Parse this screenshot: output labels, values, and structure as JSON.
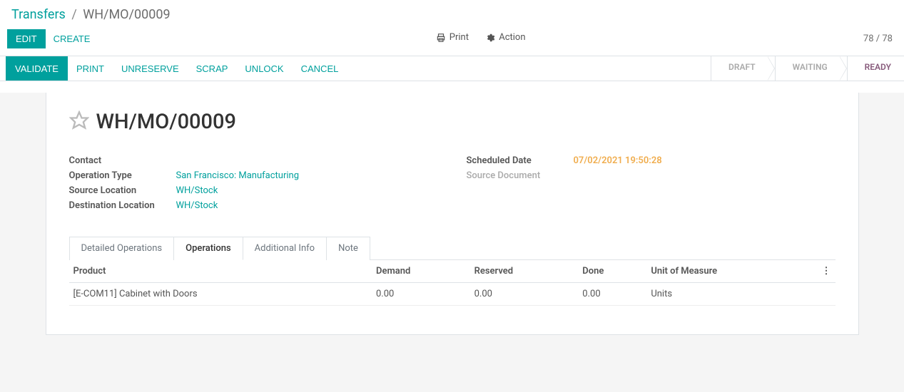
{
  "breadcrumb": {
    "root": "Transfers",
    "current": "WH/MO/00009"
  },
  "controls": {
    "edit": "EDIT",
    "create": "CREATE",
    "print": "Print",
    "action": "Action",
    "pager_current": "78",
    "pager_total": "78"
  },
  "actions": {
    "validate": "VALIDATE",
    "print": "PRINT",
    "unreserve": "UNRESERVE",
    "scrap": "SCRAP",
    "unlock": "UNLOCK",
    "cancel": "CANCEL"
  },
  "status": {
    "draft": "DRAFT",
    "waiting": "WAITING",
    "ready": "READY"
  },
  "record": {
    "title": "WH/MO/00009",
    "fields_left": {
      "contact_label": "Contact",
      "contact_value": "",
      "operation_type_label": "Operation Type",
      "operation_type_value": "San Francisco: Manufacturing",
      "source_location_label": "Source Location",
      "source_location_value": "WH/Stock",
      "destination_location_label": "Destination Location",
      "destination_location_value": "WH/Stock"
    },
    "fields_right": {
      "scheduled_date_label": "Scheduled Date",
      "scheduled_date_value": "07/02/2021 19:50:28",
      "source_document_label": "Source Document",
      "source_document_value": ""
    }
  },
  "tabs": {
    "detailed_operations": "Detailed Operations",
    "operations": "Operations",
    "additional_info": "Additional Info",
    "note": "Note"
  },
  "table": {
    "headers": {
      "product": "Product",
      "demand": "Demand",
      "reserved": "Reserved",
      "done": "Done",
      "uom": "Unit of Measure"
    },
    "rows": [
      {
        "product": "[E-COM11] Cabinet with Doors",
        "demand": "0.00",
        "reserved": "0.00",
        "done": "0.00",
        "uom": "Units"
      }
    ]
  }
}
